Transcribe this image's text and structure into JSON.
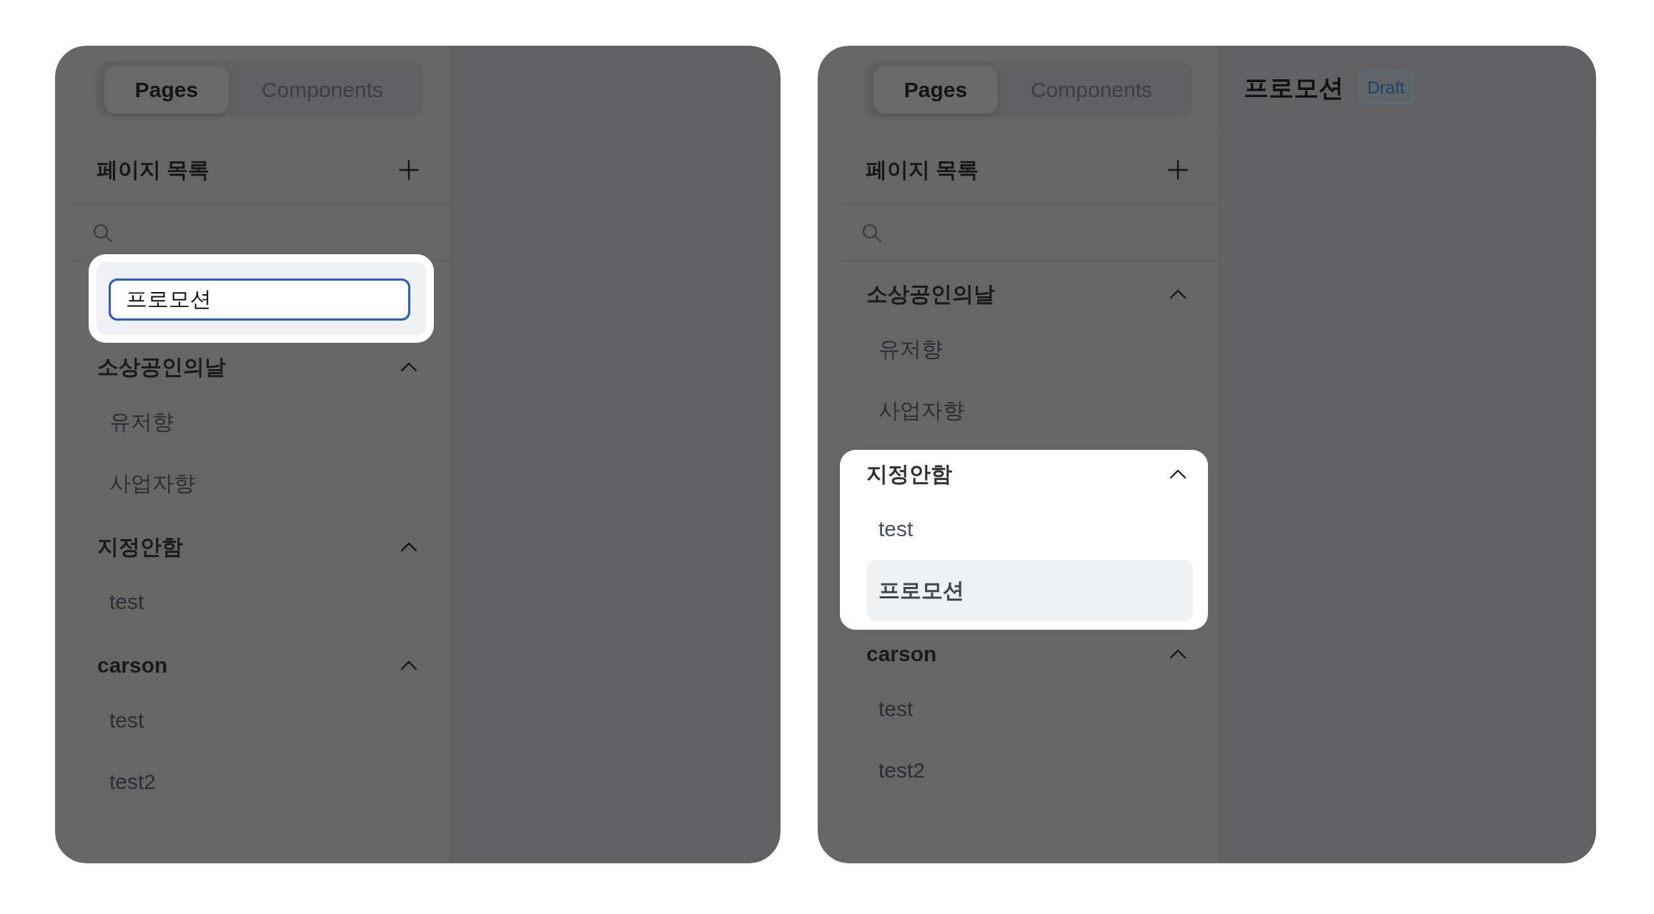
{
  "panels": [
    {
      "sidebar": {
        "tabs": [
          {
            "label": "Pages",
            "selected": true
          },
          {
            "label": "Components",
            "selected": false
          }
        ],
        "list_title": "페이지 목록",
        "new_page_field": {
          "value": "프로모션",
          "highlighted": true
        },
        "groups": [
          {
            "title": "소상공인의날",
            "expanded": true,
            "highlighted": false,
            "pages": [
              {
                "label": "유저향",
                "selected": false
              },
              {
                "label": "사업자향",
                "selected": false
              }
            ]
          },
          {
            "title": "지정안함",
            "expanded": true,
            "highlighted": false,
            "pages": [
              {
                "label": "test",
                "selected": false
              }
            ]
          },
          {
            "title": "carson",
            "expanded": true,
            "highlighted": false,
            "pages": [
              {
                "label": "test",
                "selected": false
              },
              {
                "label": "test2",
                "selected": false
              }
            ]
          }
        ]
      }
    },
    {
      "sidebar": {
        "tabs": [
          {
            "label": "Pages",
            "selected": true
          },
          {
            "label": "Components",
            "selected": false
          }
        ],
        "list_title": "페이지 목록",
        "groups": [
          {
            "title": "소상공인의날",
            "expanded": true,
            "highlighted": false,
            "pages": [
              {
                "label": "유저향",
                "selected": false
              },
              {
                "label": "사업자향",
                "selected": false
              }
            ]
          },
          {
            "title": "지정안함",
            "expanded": true,
            "highlighted": true,
            "pages": [
              {
                "label": "test",
                "selected": false
              },
              {
                "label": "프로모션",
                "selected": true
              }
            ]
          },
          {
            "title": "carson",
            "expanded": true,
            "highlighted": false,
            "pages": [
              {
                "label": "test",
                "selected": false
              },
              {
                "label": "test2",
                "selected": false
              }
            ]
          }
        ]
      },
      "page_header": {
        "title": "프로모션",
        "status": "Draft"
      }
    }
  ]
}
